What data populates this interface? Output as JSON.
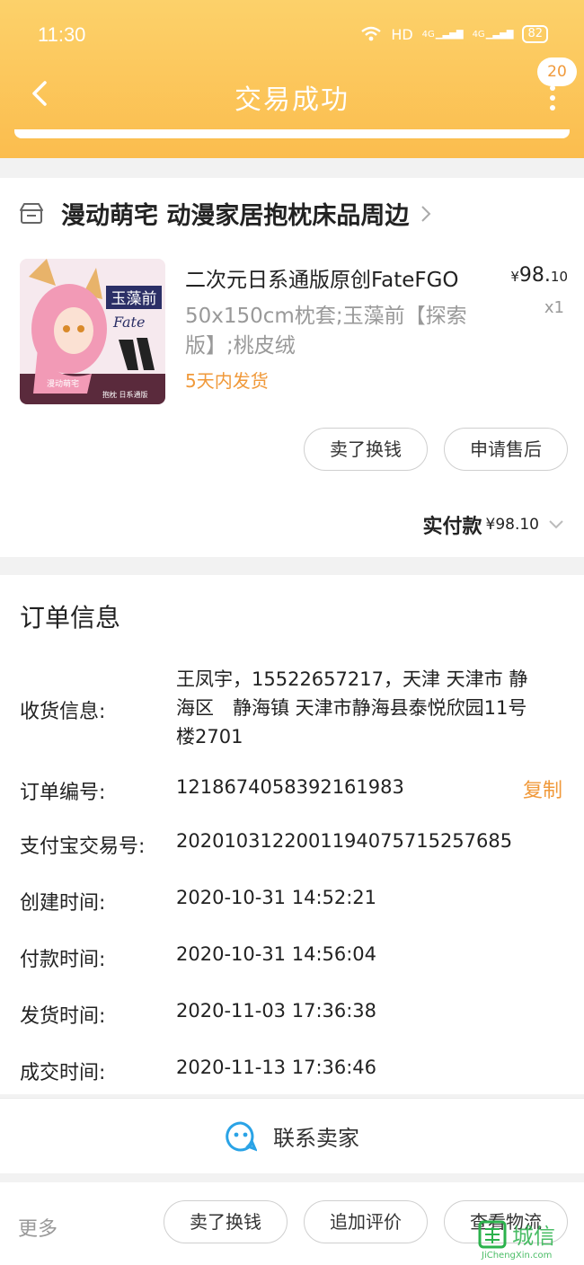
{
  "status": {
    "time": "11:30",
    "network": "HD",
    "sig1": "4G",
    "sig2": "4G",
    "battery": "82"
  },
  "nav": {
    "title": "交易成功",
    "badge": "20"
  },
  "shop": {
    "name": "漫动萌宅 动漫家居抱枕床品周边"
  },
  "product": {
    "title": "二次元日系通版原创FateFGO",
    "spec": "50x150cm枕套;玉藻前【探索版】;桃皮绒",
    "shipping": "5天内发货",
    "price_symbol": "¥",
    "price_int": "98.",
    "price_dec": "10",
    "qty": "x1",
    "thumb_text_1": "玉藻前",
    "thumb_text_2": "Fate",
    "thumb_text_3": "漫动萌宅",
    "thumb_text_4": "抱枕 日系通版"
  },
  "actions": {
    "sell": "卖了换钱",
    "after_sale": "申请售后"
  },
  "payment": {
    "label": "实付款",
    "amount": "¥98.10"
  },
  "order": {
    "title": "订单信息",
    "receiver_label": "收货信息:",
    "receiver_line1": "王凤宇，15522657217，天津 天津市 静",
    "receiver_line2": "海区　静海镇 天津市静海县泰悦欣园11号",
    "receiver_line3": "楼2701",
    "order_no_label": "订单编号:",
    "order_no": "1218674058392161983",
    "copy": "复制",
    "alipay_label": "支付宝交易号:",
    "alipay_no": "2020103122001194075715257685",
    "created_label": "创建时间:",
    "created": "2020-10-31 14:52:21",
    "paid_label": "付款时间:",
    "paid": "2020-10-31 14:56:04",
    "shipped_label": "发货时间:",
    "shipped": "2020-11-03 17:36:38",
    "closed_label": "成交时间:",
    "closed": "2020-11-13 17:36:46"
  },
  "contact": {
    "label": "联系卖家"
  },
  "bottom": {
    "more": "更多",
    "sell": "卖了换钱",
    "review": "追加评价",
    "logistics": "查看物流"
  },
  "watermark": {
    "text": "城信",
    "url": "JiChengXin.com"
  },
  "colors": {
    "header": "#fbc55a",
    "accent": "#f0993a"
  }
}
